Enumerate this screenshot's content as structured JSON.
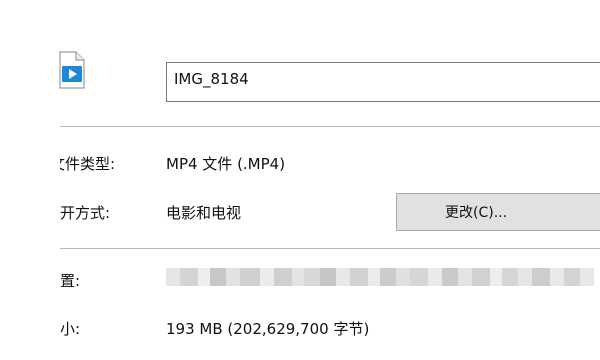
{
  "file": {
    "name_value": "IMG_8184",
    "icon": "video-file-icon"
  },
  "properties": {
    "type_label": "文件类型:",
    "type_value": "MP4 文件 (.MP4)",
    "opens_with_label": "打开方式:",
    "opens_with_value": "电影和电视",
    "change_button_label": "更改(C)...",
    "location_label": "位置:",
    "size_label": "大小:",
    "size_value": "193 MB (202,629,700 字节)"
  },
  "colors": {
    "icon_blue": "#1e88d8",
    "button_bg": "#e1e1e1",
    "divider": "#b8b8b8"
  }
}
